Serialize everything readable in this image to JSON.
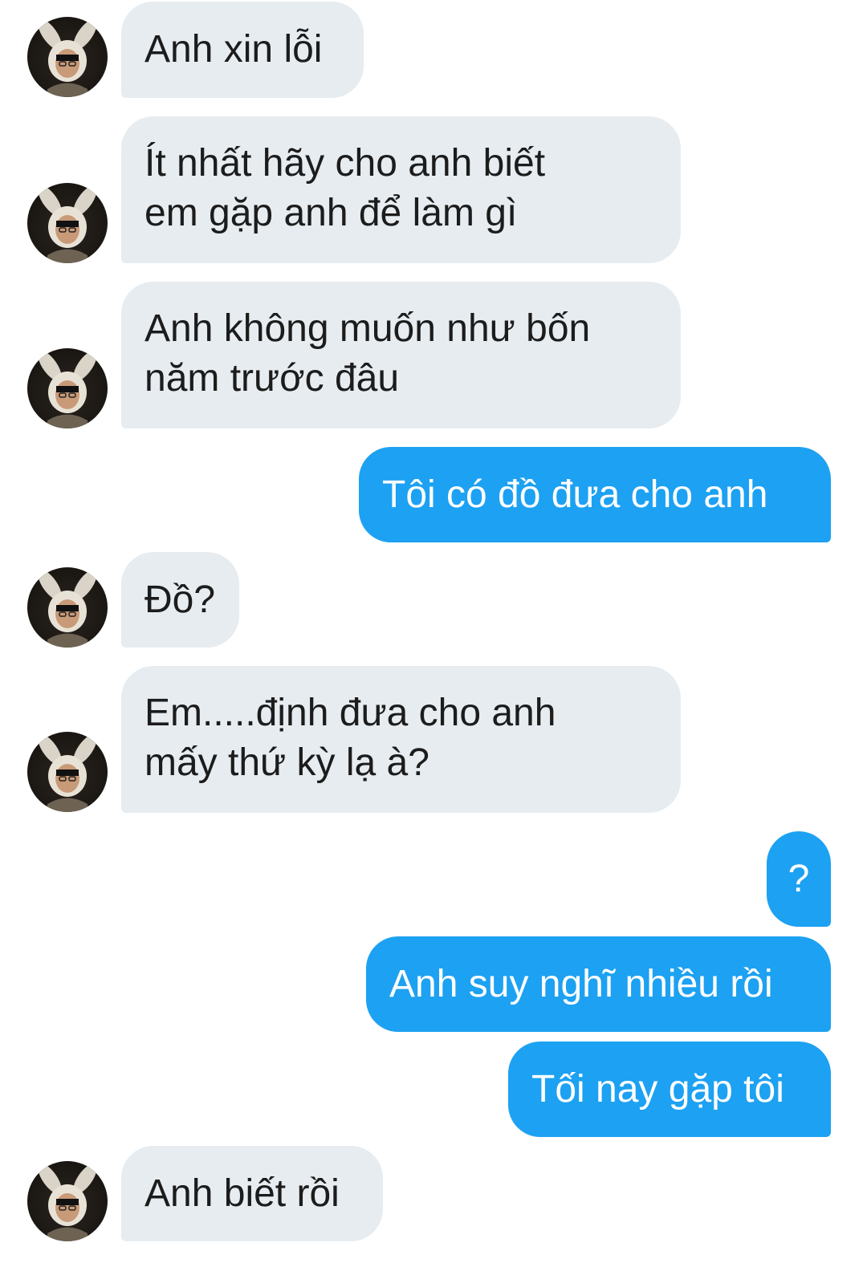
{
  "conversation": {
    "messages": [
      {
        "side": "in",
        "text": "Anh xin lỗi"
      },
      {
        "side": "in",
        "text": "Ít nhất hãy cho anh biết\nem gặp anh để làm gì"
      },
      {
        "side": "in",
        "text": "Anh không muốn như bốn\nnăm trước đâu"
      },
      {
        "side": "out",
        "text": "Tôi có đồ đưa cho anh"
      },
      {
        "side": "in",
        "text": "Đồ?"
      },
      {
        "side": "in",
        "text": "Em.....định đưa cho anh\nmấy thứ kỳ lạ à?"
      },
      {
        "side": "out",
        "text": "?"
      },
      {
        "side": "out",
        "text": "Anh suy nghĩ nhiều rồi"
      },
      {
        "side": "out",
        "text": "Tối nay gặp tôi"
      },
      {
        "side": "in",
        "text": "Anh biết rồi"
      }
    ]
  },
  "colors": {
    "incoming_bubble": "#e6ecf0",
    "outgoing_bubble": "#1da1f2",
    "incoming_text": "#1c1c1c",
    "outgoing_text": "#ffffff"
  }
}
